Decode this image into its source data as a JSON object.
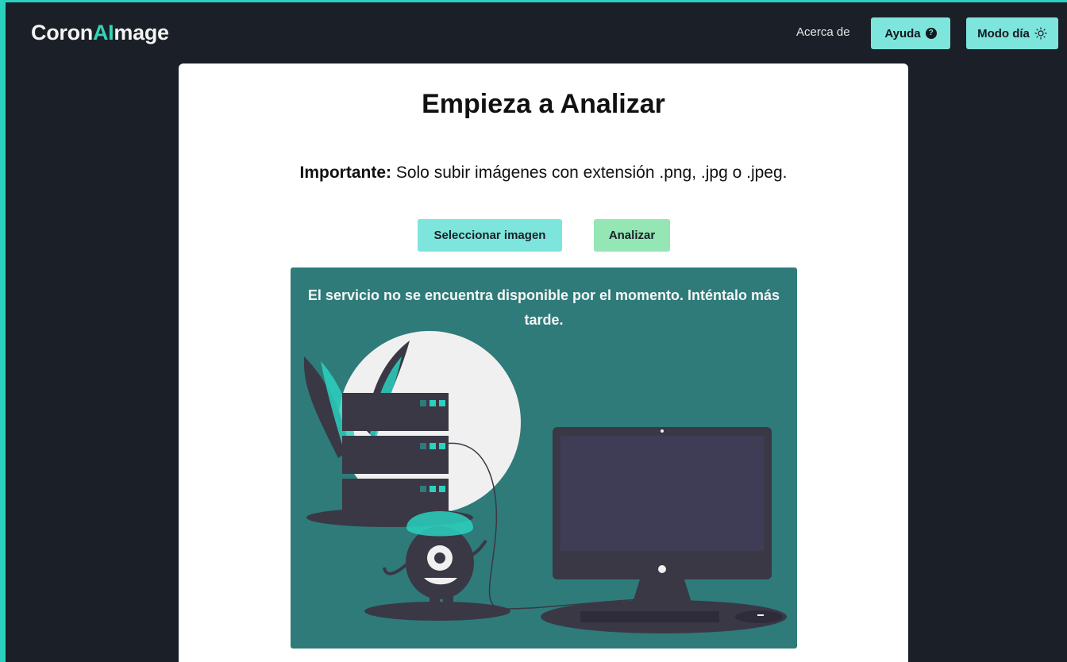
{
  "navbar": {
    "logo_prefix": "Coron",
    "logo_accent": "AI",
    "logo_suffix": "mage",
    "about_label": "Acerca de",
    "help_label": "Ayuda",
    "mode_label": "Modo día"
  },
  "main": {
    "title": "Empieza a Analizar",
    "notice_bold": "Importante:",
    "notice_text": " Solo subir imágenes con extensión .png, .jpg o .jpeg.",
    "select_button": "Seleccionar imagen",
    "analyze_button": "Analizar",
    "error_message": "El servicio no se encuentra disponible por el momento. Inténtalo más tarde."
  },
  "colors": {
    "background": "#1b1f27",
    "accent": "#2ad1bf",
    "button_primary": "#7ee5dc",
    "button_analyze": "#94e6b4",
    "error_panel": "#2e7b7a"
  },
  "icons": {
    "help": "question-circle-icon",
    "mode": "sun-icon"
  }
}
